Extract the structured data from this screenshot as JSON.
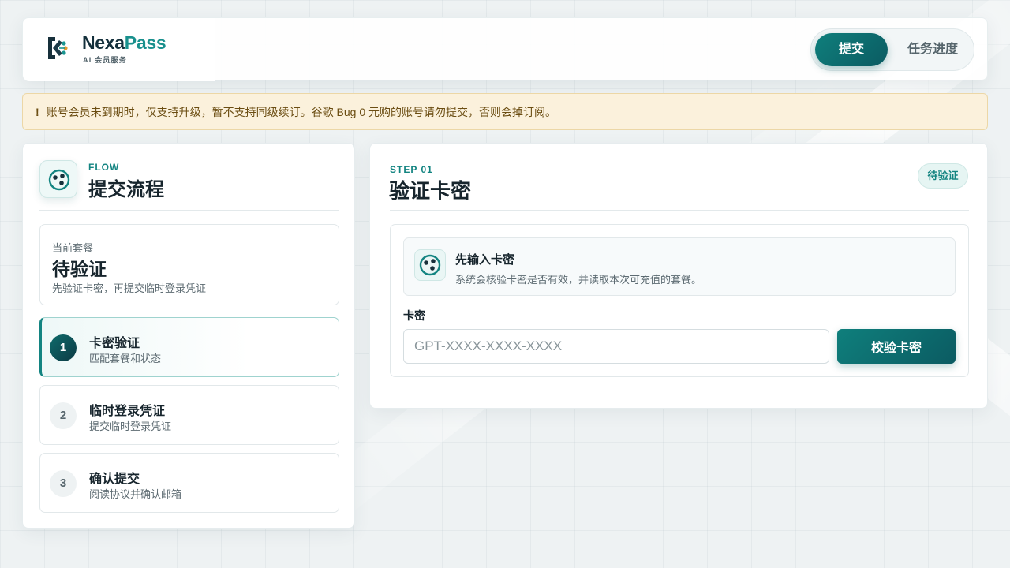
{
  "brand": {
    "name_part1": "Nexa",
    "name_part2": "Pass",
    "subtitle": "AI 会员服务",
    "logo_icon": "nexapass-logo-icon"
  },
  "nav": {
    "items": [
      {
        "label": "提交",
        "active": true
      },
      {
        "label": "任务进度",
        "active": false
      }
    ]
  },
  "notice": {
    "icon": "!",
    "text": "账号会员未到期时，仅支持升级，暂不支持同级续订。谷歌 Bug 0 元购的账号请勿提交，否则会掉订阅。"
  },
  "flow": {
    "eyebrow": "FLOW",
    "title": "提交流程",
    "icon": "flow-dots-icon",
    "plan": {
      "label": "当前套餐",
      "value": "待验证",
      "description": "先验证卡密，再提交临时登录凭证"
    },
    "steps": [
      {
        "number": "1",
        "title": "卡密验证",
        "subtitle": "匹配套餐和状态",
        "active": true
      },
      {
        "number": "2",
        "title": "临时登录凭证",
        "subtitle": "提交临时登录凭证",
        "active": false
      },
      {
        "number": "3",
        "title": "确认提交",
        "subtitle": "阅读协议并确认邮箱",
        "active": false
      }
    ]
  },
  "step_panel": {
    "eyebrow": "STEP 01",
    "heading": "验证卡密",
    "status": "待验证",
    "hint": {
      "title": "先输入卡密",
      "description": "系统会核验卡密是否有效，并读取本次可充值的套餐。",
      "icon": "flow-dots-icon"
    },
    "field_label": "卡密",
    "input_placeholder": "GPT-XXXX-XXXX-XXXX",
    "input_value": "",
    "button_label": "校验卡密"
  },
  "colors": {
    "accent": "#138481",
    "accent_dark": "#0b5b62",
    "notice_bg": "#fbf1dc",
    "notice_text": "#6b4d12"
  }
}
